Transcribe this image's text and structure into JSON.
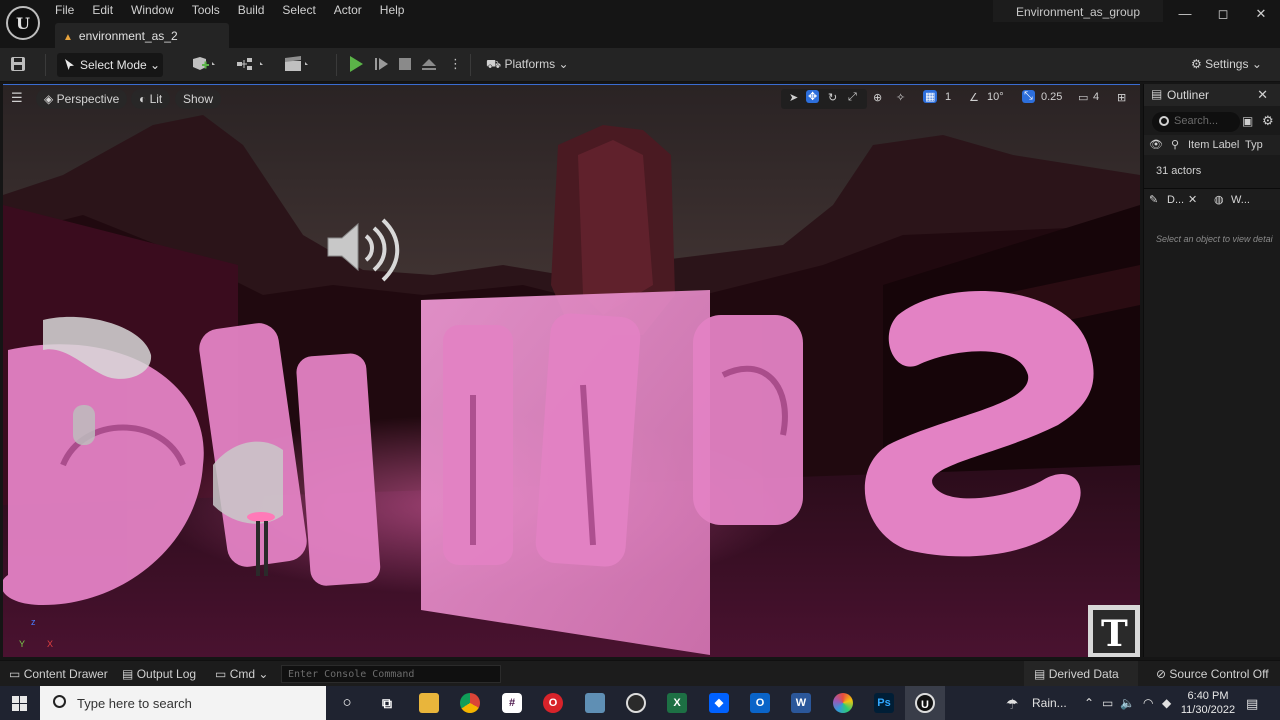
{
  "menu": {
    "logo": "U",
    "items": [
      "File",
      "Edit",
      "Window",
      "Tools",
      "Build",
      "Select",
      "Actor",
      "Help"
    ],
    "project_name": "Environment_as_group"
  },
  "window_controls": {
    "minimize": "—",
    "maximize": "◻",
    "close": "✕"
  },
  "level_tab": {
    "label": "environment_as_2"
  },
  "toolbar": {
    "select_mode_label": "Select Mode",
    "platforms_label": "Platforms",
    "settings_label": "Settings"
  },
  "viewport": {
    "perspective_label": "Perspective",
    "lit_label": "Lit",
    "show_label": "Show",
    "grid_snap_value": "1",
    "rotation_snap_value": "10°",
    "scale_snap_value": "0.25",
    "camera_speed_value": "4",
    "axis_z": "z",
    "axis_y": "Y",
    "axis_x": "X",
    "scene_text": "Shaped",
    "text_actor_glyph": "T"
  },
  "outliner": {
    "title": "Outliner",
    "search_placeholder": "Search...",
    "col_item_label": "Item Label",
    "col_type": "Typ",
    "actor_count": "31 actors",
    "details_tab": "D...",
    "world_tab": "W...",
    "empty_hint": "Select an object to view detai"
  },
  "statusbar": {
    "content_drawer": "Content Drawer",
    "output_log": "Output Log",
    "cmd_label": "Cmd",
    "console_placeholder": "Enter Console Command",
    "derived_data": "Derived Data",
    "source_control": "Source Control Off"
  },
  "taskbar": {
    "search_placeholder": "Type here to search",
    "weather": "Rain...",
    "time": "6:40 PM",
    "date": "11/30/2022"
  },
  "colors": {
    "accent_blue": "#2d6fdc",
    "play_green": "#5bb448",
    "scene_pink": "#e382c4"
  }
}
